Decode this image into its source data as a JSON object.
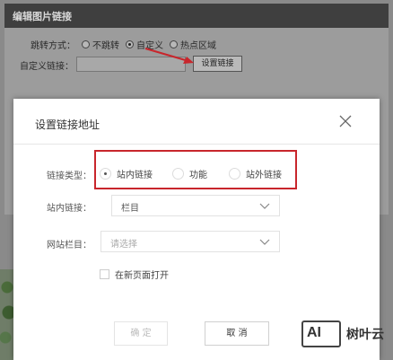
{
  "background": {
    "title": "编辑图片链接",
    "jump_label": "跳转方式：",
    "jump_options": [
      "不跳转",
      "自定义",
      "热点区域"
    ],
    "jump_selected": "自定义",
    "custom_link_label": "自定义链接：",
    "set_link_button": "设置链接"
  },
  "dialog": {
    "title": "设置链接地址",
    "link_type_label": "链接类型：",
    "link_types": [
      "站内链接",
      "功能",
      "站外链接"
    ],
    "link_type_selected": "站内链接",
    "internal_link_label": "站内链接：",
    "internal_link_value": "栏目",
    "site_column_label": "网站栏目：",
    "site_column_placeholder": "请选择",
    "open_new_page_label": "在新页面打开",
    "ok_button": "确 定",
    "cancel_button": "取 消"
  },
  "watermark": {
    "logo_text": "AI",
    "brand": "树叶云"
  },
  "colors": {
    "highlight": "#c8262c",
    "title_bar": "#3f3f3f"
  }
}
